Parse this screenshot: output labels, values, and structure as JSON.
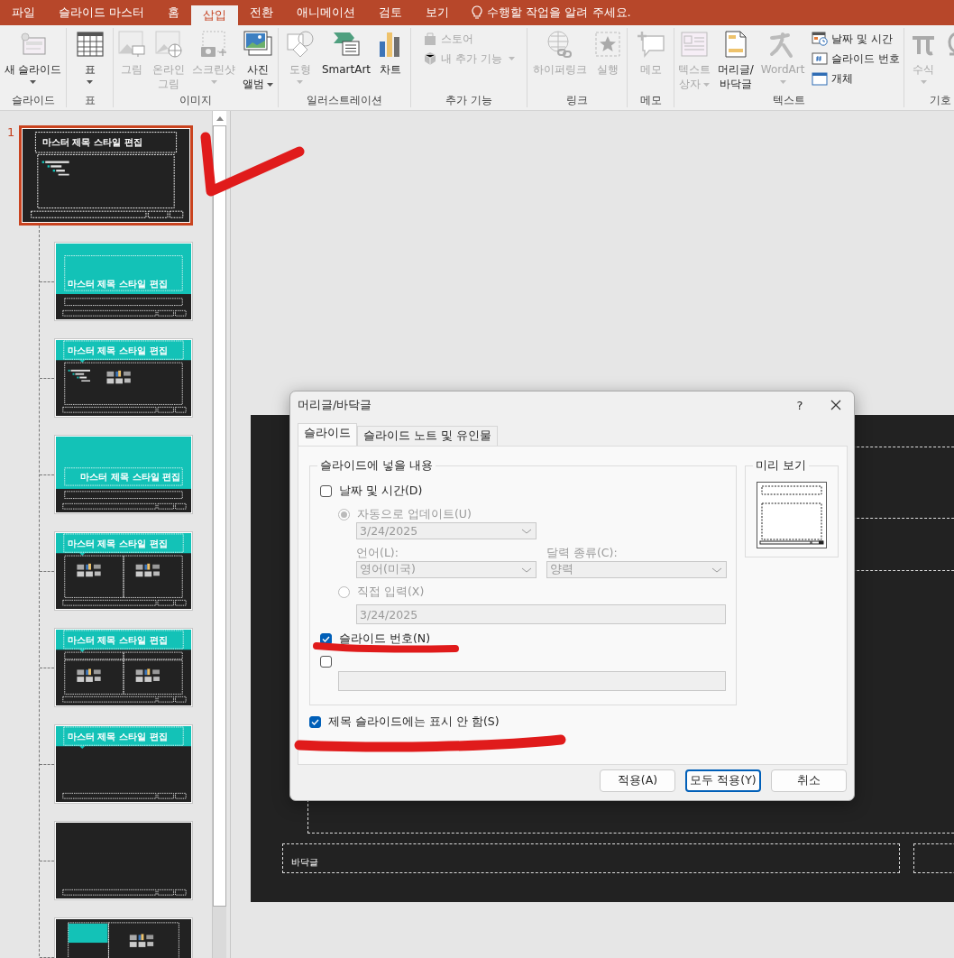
{
  "app_tabs": [
    {
      "label": "파일",
      "selected": false
    },
    {
      "label": "슬라이드 마스터",
      "selected": false
    },
    {
      "label": "홈",
      "selected": false
    },
    {
      "label": "삽입",
      "selected": true
    },
    {
      "label": "전환",
      "selected": false
    },
    {
      "label": "애니메이션",
      "selected": false
    },
    {
      "label": "검토",
      "selected": false
    },
    {
      "label": "보기",
      "selected": false
    }
  ],
  "tell_me": "수행할 작업을 알려 주세요.",
  "ribbon": [
    {
      "label": "슬라이드",
      "items": [
        {
          "kind": "large",
          "lines": [
            "새 슬라이드"
          ],
          "dropdown": true,
          "disabled": false
        }
      ]
    },
    {
      "label": "표",
      "items": [
        {
          "kind": "large",
          "lines": [
            "표"
          ],
          "dropdown": true,
          "disabled": false
        }
      ]
    },
    {
      "label": "이미지",
      "items": [
        {
          "kind": "large",
          "lines": [
            "그림"
          ],
          "dropdown": false,
          "disabled": true
        },
        {
          "kind": "large",
          "lines": [
            "온라인",
            "그림"
          ],
          "dropdown": false,
          "disabled": true
        },
        {
          "kind": "large",
          "lines": [
            "스크린샷"
          ],
          "dropdown": true,
          "disabled": true
        },
        {
          "kind": "large",
          "lines": [
            "사진",
            "앨범"
          ],
          "dropdown": true,
          "disabled": false
        }
      ]
    },
    {
      "label": "일러스트레이션",
      "items": [
        {
          "kind": "large",
          "lines": [
            "도형"
          ],
          "dropdown": true,
          "disabled": true
        },
        {
          "kind": "large",
          "lines": [
            "SmartArt"
          ],
          "dropdown": false,
          "disabled": false
        },
        {
          "kind": "large",
          "lines": [
            "차트"
          ],
          "dropdown": false,
          "disabled": false
        }
      ]
    },
    {
      "label": "추가 기능",
      "items": [
        {
          "kind": "small",
          "lines": [
            "스토어"
          ],
          "dropdown": false,
          "disabled": true
        },
        {
          "kind": "small",
          "lines": [
            "내 추가 기능"
          ],
          "dropdown": true,
          "disabled": true
        }
      ]
    },
    {
      "label": "링크",
      "items": [
        {
          "kind": "large",
          "lines": [
            "하이퍼링크"
          ],
          "dropdown": false,
          "disabled": true
        },
        {
          "kind": "large",
          "lines": [
            "실행"
          ],
          "dropdown": false,
          "disabled": true
        }
      ]
    },
    {
      "label": "메모",
      "items": [
        {
          "kind": "large",
          "lines": [
            "메모"
          ],
          "dropdown": false,
          "disabled": true
        }
      ]
    },
    {
      "label": "텍스트",
      "items": [
        {
          "kind": "large",
          "lines": [
            "텍스트",
            "상자"
          ],
          "dropdown": true,
          "disabled": true
        },
        {
          "kind": "large",
          "lines": [
            "머리글/",
            "바닥글"
          ],
          "dropdown": false,
          "disabled": false
        },
        {
          "kind": "large",
          "lines": [
            "WordArt"
          ],
          "dropdown": true,
          "disabled": true
        },
        {
          "kind": "small",
          "lines": [
            "날짜 및 시간"
          ],
          "dropdown": false,
          "disabled": false
        },
        {
          "kind": "small",
          "lines": [
            "슬라이드 번호"
          ],
          "dropdown": false,
          "disabled": false
        },
        {
          "kind": "small",
          "lines": [
            "개체"
          ],
          "dropdown": false,
          "disabled": false
        }
      ]
    },
    {
      "label": "기호",
      "items": [
        {
          "kind": "large",
          "lines": [
            "수식"
          ],
          "dropdown": true,
          "disabled": true
        },
        {
          "kind": "large"
        }
      ]
    }
  ],
  "thumbnails": [
    {
      "kind": "title-content",
      "number": "1",
      "title": "마스터 제목 스타일 편집",
      "selected": true
    },
    {
      "kind": "title-slide",
      "title": "마스터 제목 스타일 편집",
      "selected": false
    },
    {
      "kind": "title-content-pics",
      "title": "마스터 제목 스타일 편집",
      "selected": false
    },
    {
      "kind": "section",
      "title": "마스터 제목 스타일 편집",
      "selected": false
    },
    {
      "kind": "two-content",
      "title": "마스터 제목 스타일 편집",
      "selected": false
    },
    {
      "kind": "comparison",
      "title": "마스터 제목 스타일 편집",
      "selected": false
    },
    {
      "kind": "title-only",
      "title": "마스터 제목 스타일 편집",
      "selected": false
    },
    {
      "kind": "blank",
      "selected": false
    },
    {
      "kind": "content-caption",
      "selected": false
    }
  ],
  "slide": {
    "footer_text": "바닥글"
  },
  "dialog": {
    "title": "머리글/바닥글",
    "help": "?",
    "tabs": [
      {
        "label": "슬라이드",
        "selected": true
      },
      {
        "label": "슬라이드 노트 및 유인물",
        "selected": false
      }
    ],
    "group_title": "슬라이드에 넣을 내용",
    "date_time": {
      "label": "날짜 및 시간(D)",
      "checked": false
    },
    "auto_update": {
      "label": "자동으로 업데이트(U)",
      "selected": true,
      "value": "3/24/2025"
    },
    "language": {
      "label": "언어(L):",
      "value": "영어(미국)"
    },
    "calendar": {
      "label": "달력 종류(C):",
      "value": "양력"
    },
    "fixed": {
      "label": "직접 입력(X)",
      "selected": false,
      "value": "3/24/2025"
    },
    "slide_number": {
      "label": "슬라이드 번호(N)",
      "checked": true
    },
    "footer": {
      "checked": false
    },
    "preview_title": "미리 보기",
    "dont_show_on_title": {
      "label": "제목 슬라이드에는 표시 안 함(S)",
      "checked": true
    },
    "buttons": [
      {
        "label": "적용(A)",
        "default": false
      },
      {
        "label": "모두 적용(Y)",
        "default": true
      },
      {
        "label": "취소",
        "default": false
      }
    ]
  }
}
